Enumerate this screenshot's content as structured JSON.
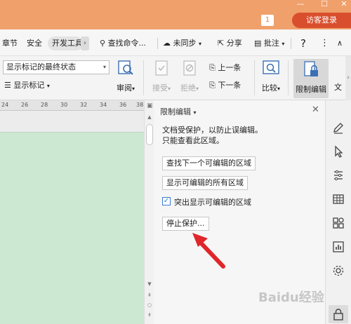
{
  "titlebar": {
    "notification_count": "1",
    "login_label": "访客登录"
  },
  "tabs": [
    {
      "label": "章节"
    },
    {
      "label": "安全"
    },
    {
      "label": "开发工具"
    }
  ],
  "toolbar": {
    "search_label": "查找命令...",
    "sync_label": "未同步",
    "share_label": "分享",
    "annotate_label": "批注",
    "help": "?",
    "more": "⋮",
    "collapse": "∧"
  },
  "ribbon": {
    "markup_state_value": "显示标记的最终状态",
    "show_markup_label": "显示标记",
    "review_label": "审阅",
    "accept_label": "接受",
    "reject_label": "拒绝",
    "prev_label": "上一条",
    "next_label": "下一条",
    "compare_label": "比较",
    "restrict_edit_label": "限制编辑",
    "doc_label": "文"
  },
  "ruler": {
    "ticks": [
      "24",
      "26",
      "28",
      "30",
      "32",
      "34",
      "36",
      "38"
    ]
  },
  "pane": {
    "title": "限制编辑",
    "message_line1": "文档受保护，以防止误编辑。",
    "message_line2": "只能查看此区域。",
    "find_next_label": "查找下一个可编辑的区域",
    "show_all_label": "显示可编辑的所有区域",
    "highlight_label": "突出显示可编辑的区域",
    "highlight_checked": true,
    "stop_protect_label": "停止保护..."
  },
  "watermark": "Baidu经验",
  "colors": {
    "titlebar": "#f0a06b",
    "login_button": "#d94f2e",
    "doc_page": "#cde8d2",
    "arrow": "#e0262a"
  }
}
